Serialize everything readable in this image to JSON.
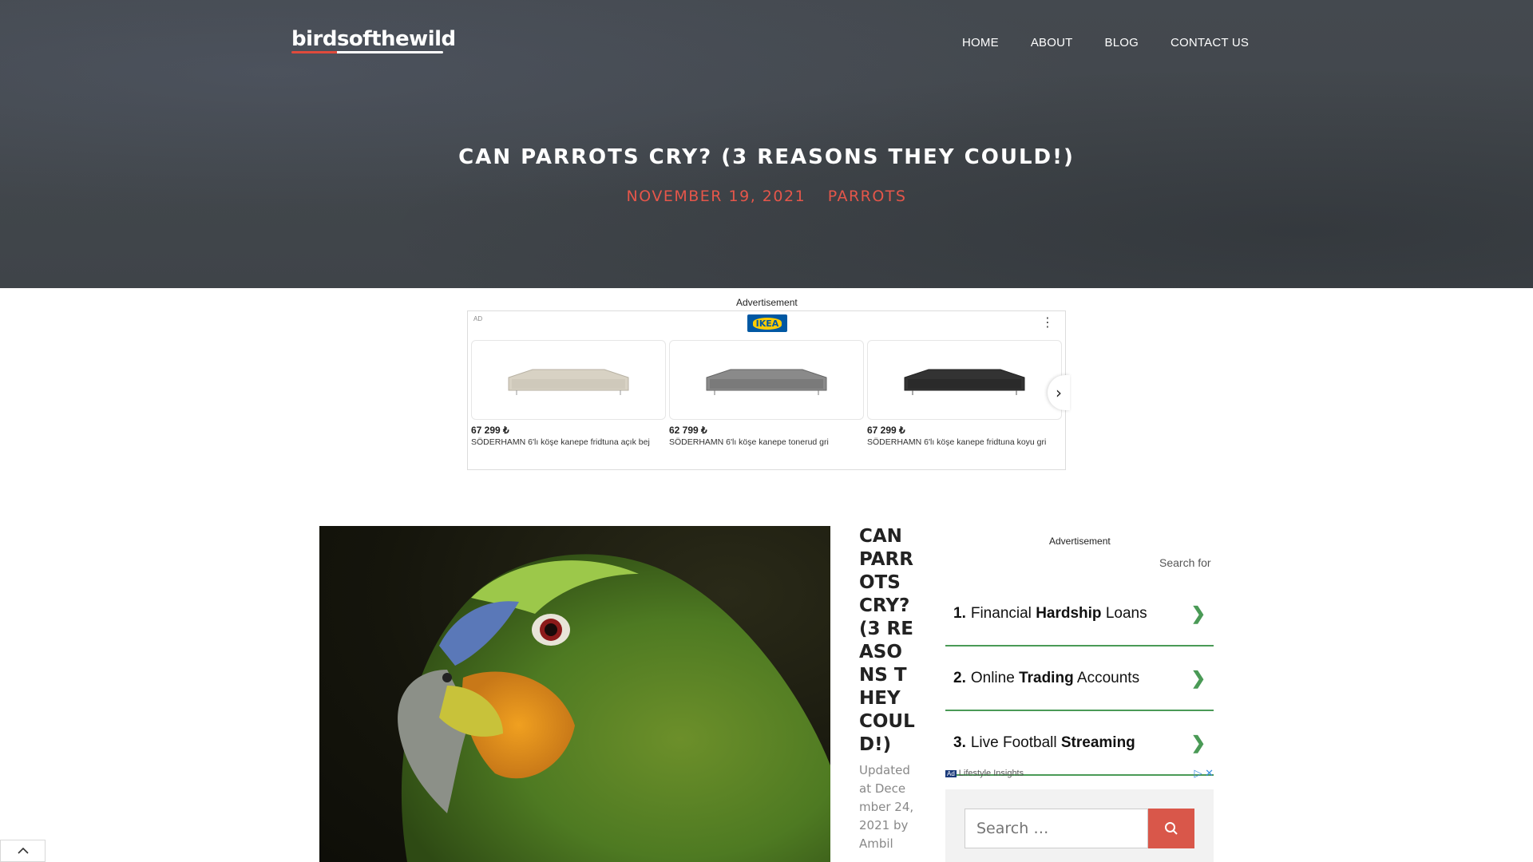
{
  "site": {
    "logo": "birdsofthewild",
    "nav": [
      "HOME",
      "ABOUT",
      "BLOG",
      "CONTACT US"
    ]
  },
  "hero": {
    "title": "CAN PARROTS CRY? (3 REASONS THEY COULD!)",
    "date": "NOVEMBER 19, 2021",
    "category": "PARROTS"
  },
  "top_ad": {
    "label": "Advertisement",
    "tag": "AD",
    "brand": "IKEA",
    "products": [
      {
        "price": "67 299 ₺",
        "name": "SÖDERHAMN 6'lı köşe kanepe fridtuna açık bej",
        "color": "#d8d2c4"
      },
      {
        "price": "62 799 ₺",
        "name": "SÖDERHAMN 6'lı köşe kanepe tonerud gri",
        "color": "#8a8a8a"
      },
      {
        "price": "67 299 ₺",
        "name": "SÖDERHAMN 6'lı köşe kanepe fridtuna koyu gri",
        "color": "#333333"
      }
    ]
  },
  "post": {
    "title": "CAN PARROTS CRY? (3 REASONS THEY COULD!)",
    "meta": "Updated at December 24, 2021 by Ambil"
  },
  "sidebar": {
    "ad_label": "Advertisement",
    "search_for": "Search for",
    "links": [
      {
        "num": "1.",
        "pre": "Financial ",
        "bold": "Hardship",
        "post": " Loans"
      },
      {
        "num": "2.",
        "pre": "Online ",
        "bold": "Trading",
        "post": " Accounts"
      },
      {
        "num": "3.",
        "pre": "Live Football ",
        "bold": "Streaming",
        "post": ""
      }
    ],
    "ad_footer_badge": "Ad",
    "ad_footer": "Lifestyle Insights",
    "search_placeholder": "Search …"
  },
  "colors": {
    "accent": "#e5564a",
    "link_green": "#4a9a56",
    "hero_bg": "#43484d"
  }
}
